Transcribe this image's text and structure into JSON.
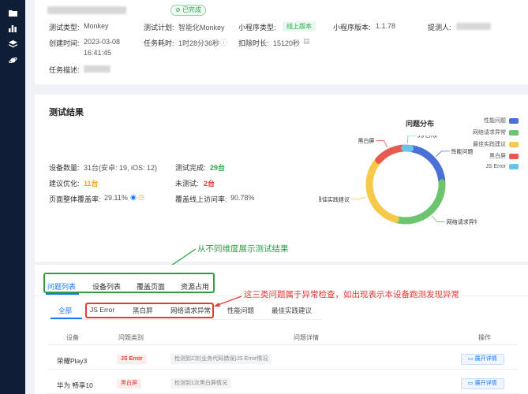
{
  "nav": {
    "icons": [
      "folder-icon",
      "chart-icon",
      "layers-icon",
      "planet-icon"
    ]
  },
  "task": {
    "status": "已完成",
    "fields": [
      {
        "label": "测试类型:",
        "value": "Monkey"
      },
      {
        "label": "测试计划:",
        "value": "智能化Monkey"
      },
      {
        "label": "小程序类型:",
        "value": "线上版本"
      },
      {
        "label": "小程序版本:",
        "value": "1.1.78"
      },
      {
        "label": "提测人:",
        "value": ""
      },
      {
        "label": "创建时间:",
        "value": "2023-03-08"
      },
      {
        "label": "",
        "value": "16:41:45"
      },
      {
        "label": "任务耗时:",
        "value": "1时28分36秒"
      },
      {
        "label": "扣除时长:",
        "value": "15120秒"
      },
      {
        "label": "任务描述:",
        "value": ""
      }
    ]
  },
  "results": {
    "title": "测试结果",
    "rows": [
      {
        "label": "设备数量:",
        "value": "31台(安卓: 19, iOS: 12)"
      },
      {
        "label": "测试完成:",
        "value": "29台"
      },
      {
        "label": "建议优化:",
        "value": "11台"
      },
      {
        "label": "未测试:",
        "value": "2台"
      },
      {
        "label": "页面整体覆盖率:",
        "value": "29.11%"
      },
      {
        "label": "覆盖线上访问率:",
        "value": "90.78%"
      }
    ],
    "distribution_title": "问题分布",
    "legend": [
      {
        "name": "性能问题",
        "color": "#4a6fd6"
      },
      {
        "name": "网络请求异常",
        "color": "#6cc46f"
      },
      {
        "name": "最佳实践建议",
        "color": "#f7c94b"
      },
      {
        "name": "黑白屏",
        "color": "#e85a4f"
      },
      {
        "name": "JS Error",
        "color": "#6bc3ea"
      }
    ],
    "donut_labels": [
      "JS Error",
      "黑白屏",
      "性能问题",
      "最佳实践建议",
      "网络请求异常"
    ]
  },
  "chart_data": {
    "type": "pie",
    "categories": [
      "性能问题",
      "网络请求异常",
      "最佳实践建议",
      "黑白屏",
      "JS Error"
    ],
    "values": [
      20,
      28,
      30,
      12,
      3
    ]
  },
  "annotations": {
    "green_note": "从不同维度展示测试结果",
    "red_note": "这三类问题属于异常检查，如出现表示本设备跑测发现异常"
  },
  "tabs": [
    "问题列表",
    "设备列表",
    "覆盖页面",
    "资源占用"
  ],
  "subtabs": [
    "全部",
    "JS Error",
    "黑白屏",
    "网络请求异常",
    "性能问题",
    "最佳实践建议"
  ],
  "table": {
    "headers": [
      "设备",
      "问题类别",
      "问题详情",
      "操作"
    ],
    "rows": [
      {
        "device": "荣耀Play3",
        "category": "JS Error",
        "detail": "检测到2次(业务代码错误)JS Error情况",
        "action": "展开详情"
      },
      {
        "device": "华为 畅享10",
        "category": "黑白屏",
        "detail": "检测到1次黑白屏情况",
        "action": "展开详情"
      }
    ]
  }
}
